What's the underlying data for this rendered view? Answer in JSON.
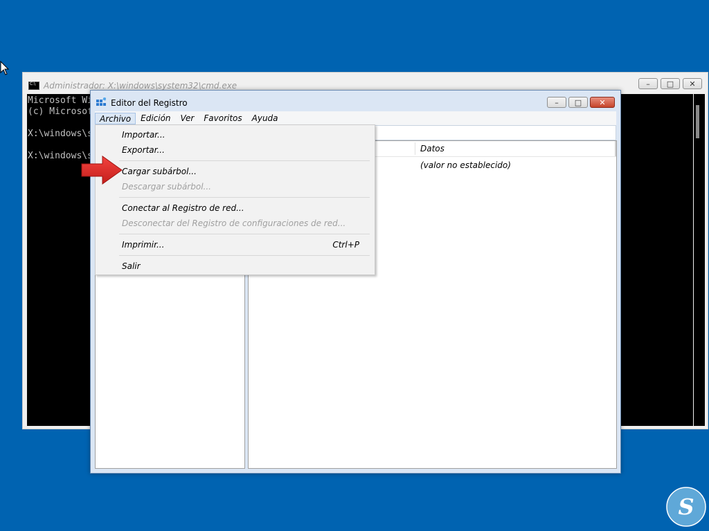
{
  "cmd": {
    "title": "Administrador: X:\\windows\\system32\\cmd.exe",
    "lines": [
      "Microsoft Wi",
      "(c) Microsof",
      "",
      "X:\\windows\\s",
      "",
      "X:\\windows\\s"
    ],
    "buttons": {
      "minimize": "–",
      "maximize": "□",
      "close": "✕"
    }
  },
  "regedit": {
    "title": "Editor del Registro",
    "buttons": {
      "minimize": "–",
      "maximize": "□",
      "close": "✕"
    },
    "menu": [
      "Archivo",
      "Edición",
      "Ver",
      "Favoritos",
      "Ayuda"
    ],
    "list": {
      "column_datos": "Datos",
      "row_valor": "(valor no establecido)"
    }
  },
  "archivo_menu": {
    "items": [
      {
        "label": "Importar...",
        "enabled": true
      },
      {
        "label": "Exportar...",
        "enabled": true
      },
      {
        "label": "Cargar subárbol...",
        "enabled": true
      },
      {
        "label": "Descargar subárbol...",
        "enabled": false
      },
      {
        "label": "Conectar al Registro de red...",
        "enabled": true
      },
      {
        "label": "Desconectar del Registro de configuraciones de red...",
        "enabled": false
      },
      {
        "label": "Imprimir...",
        "enabled": true,
        "shortcut": "Ctrl+P"
      },
      {
        "label": "Salir",
        "enabled": true
      }
    ]
  },
  "annotation": {
    "arrow_color": "#e8302f",
    "points_to": "Cargar subárbol..."
  },
  "colors": {
    "desktop": "#0063b1",
    "logo": "#5fa8d8"
  },
  "logo_letter": "S"
}
